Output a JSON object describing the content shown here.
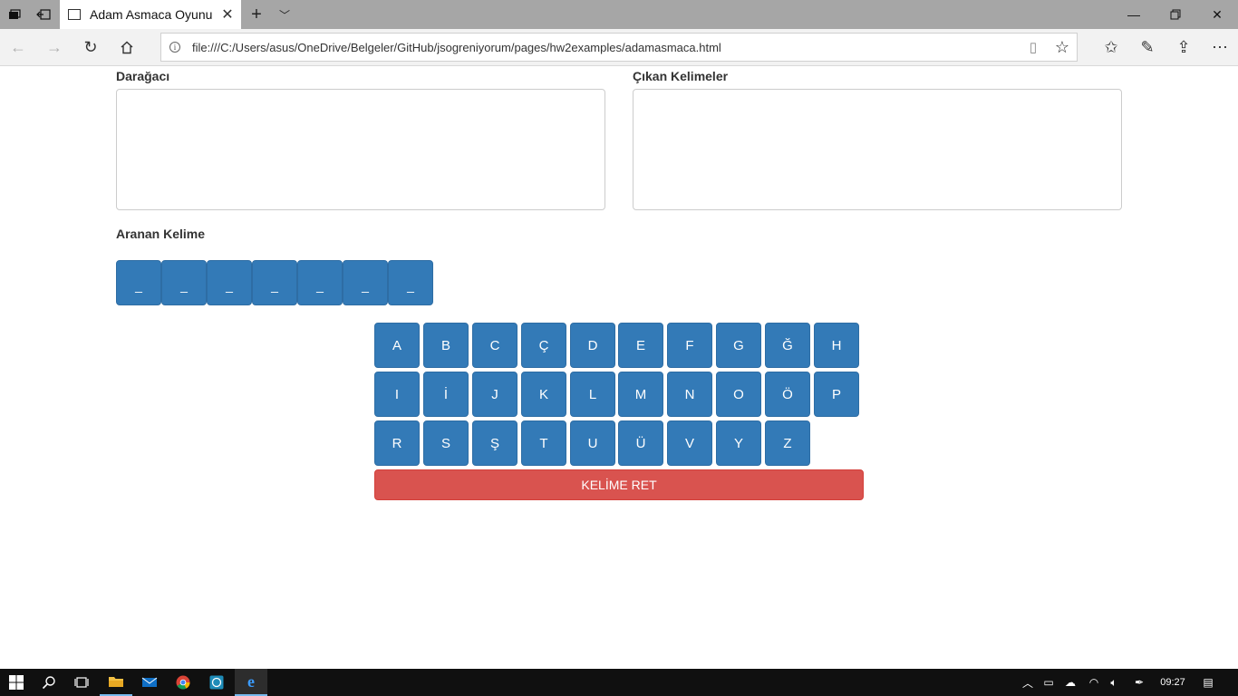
{
  "browser": {
    "tab_title": "Adam Asmaca Oyunu",
    "url": "file:///C:/Users/asus/OneDrive/Belgeler/GitHub/jsogreniyorum/pages/hw2examples/adamasmaca.html"
  },
  "game": {
    "gallows_label": "Darağacı",
    "used_words_label": "Çıkan Kelimeler",
    "target_word_label": "Aranan Kelime",
    "slots": [
      "_",
      "_",
      "_",
      "_",
      "_",
      "_",
      "_"
    ],
    "keyboard_rows": [
      [
        "A",
        "B",
        "C",
        "Ç",
        "D",
        "E",
        "F",
        "G",
        "Ğ",
        "H"
      ],
      [
        "I",
        "İ",
        "J",
        "K",
        "L",
        "M",
        "N",
        "O",
        "Ö",
        "P"
      ],
      [
        "R",
        "S",
        "Ş",
        "T",
        "U",
        "Ü",
        "V",
        "Y",
        "Z"
      ]
    ],
    "reject_button": "KELİME RET"
  },
  "taskbar": {
    "clock": "09:27"
  },
  "colors": {
    "primary": "#337ab7",
    "danger": "#d9534f"
  }
}
